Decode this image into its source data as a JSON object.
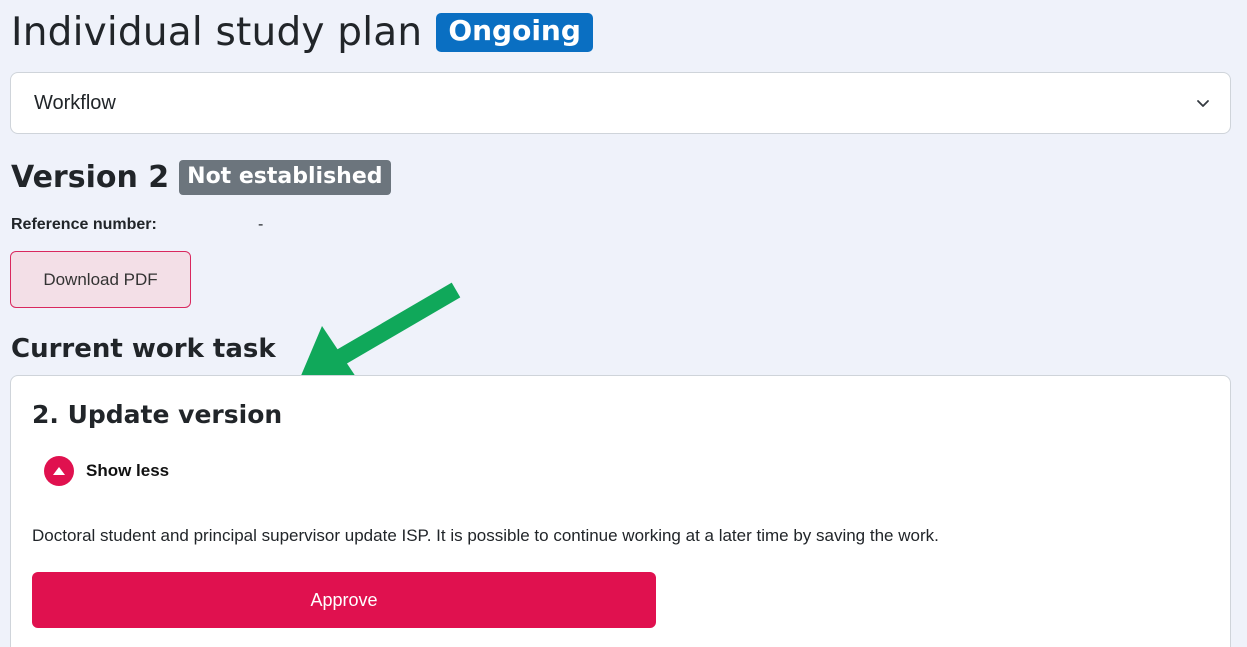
{
  "header": {
    "title": "Individual study plan",
    "status_badge": "Ongoing"
  },
  "workflow_select": {
    "selected": "Workflow",
    "icon": "chevron-down-icon"
  },
  "version": {
    "title": "Version 2",
    "status_badge": "Not established",
    "reference_label": "Reference number:",
    "reference_value": "-"
  },
  "download_pdf_label": "Download PDF",
  "current_task": {
    "section_title": "Current work task",
    "task_title": "2. Update version",
    "toggle_label": "Show less",
    "toggle_icon": "chevron-up-circle-icon",
    "description": "Doctoral student and principal supervisor update ISP. It is possible to continue working at a later time by saving the work.",
    "approve_label": "Approve"
  },
  "colors": {
    "accent": "#e0114f",
    "ongoing_badge": "#0a6fc2",
    "status_badge": "#6c757d",
    "annotation_arrow": "#10a85a"
  }
}
